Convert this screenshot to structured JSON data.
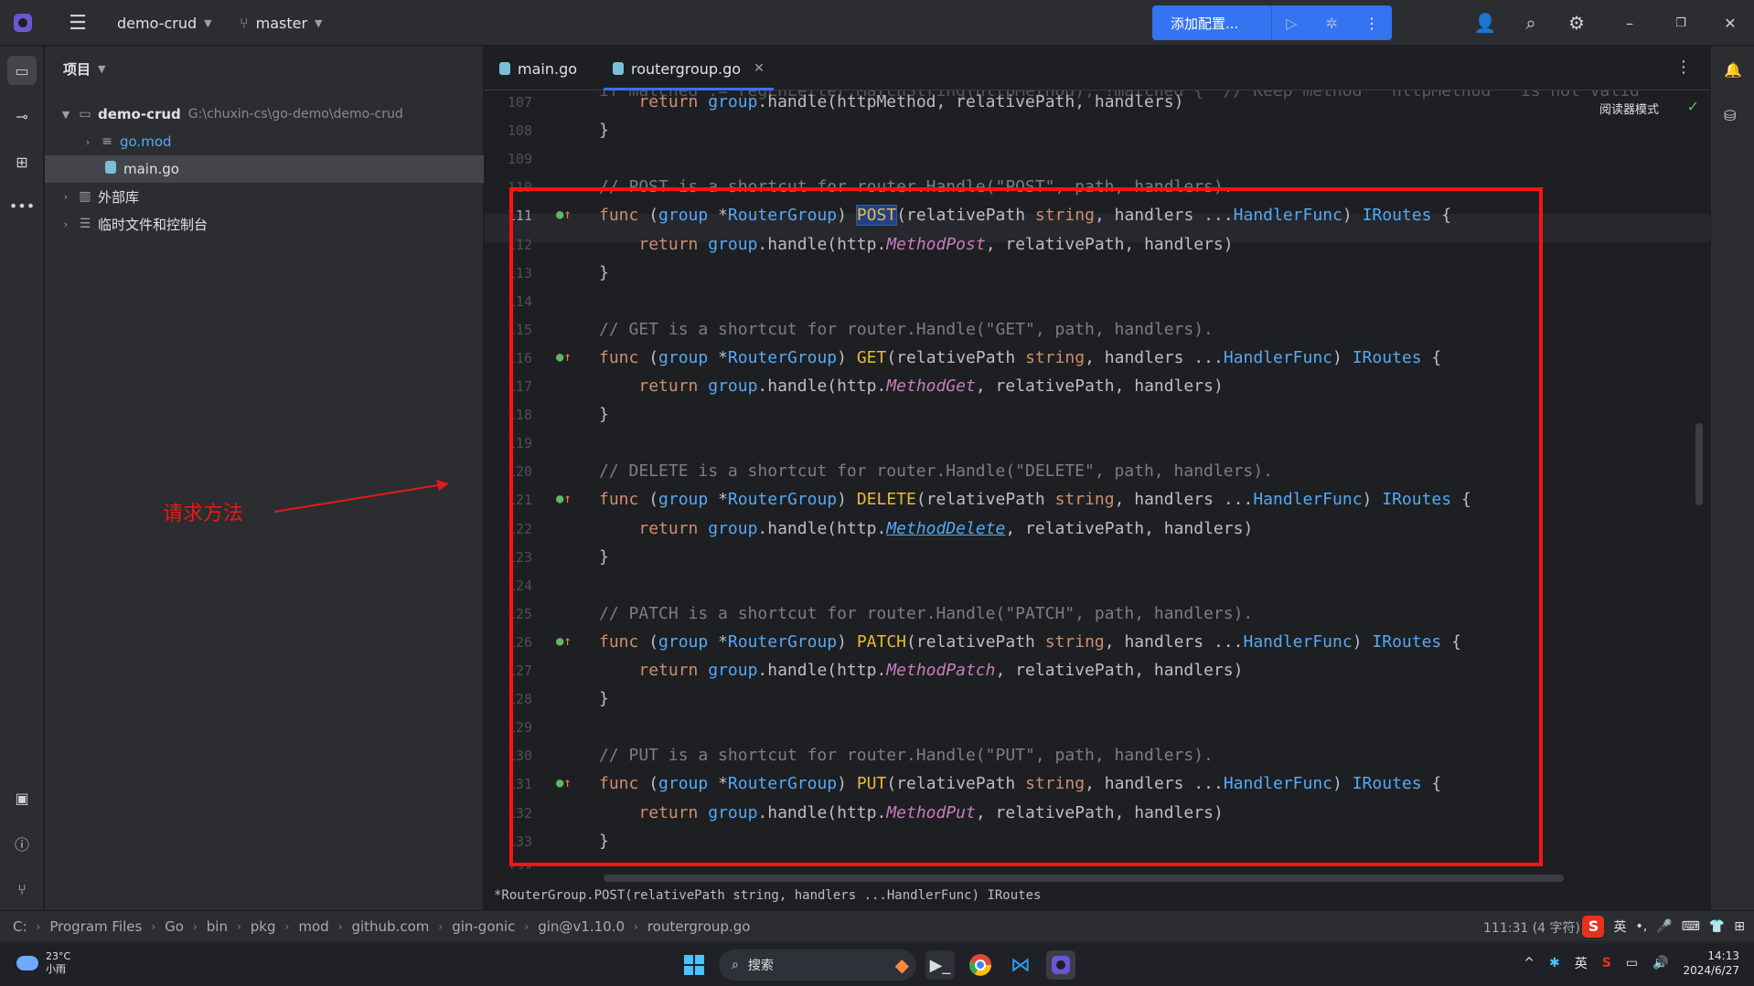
{
  "titlebar": {
    "project": "demo-crud",
    "branch": "master",
    "run_config": "添加配置..."
  },
  "project_panel": {
    "header": "项目",
    "tree": [
      {
        "label": "demo-crud",
        "path": "G:\\chuxin-cs\\go-demo\\demo-crud"
      },
      {
        "label": "go.mod"
      },
      {
        "label": "main.go"
      },
      {
        "label": "外部库"
      },
      {
        "label": "临时文件和控制台"
      }
    ]
  },
  "annotation": {
    "text": "请求方法"
  },
  "tabs": [
    {
      "label": "main.go"
    },
    {
      "label": "routergroup.go"
    }
  ],
  "editor": {
    "reader_mode": "阅读器模式",
    "top_partial": "if matched := regEnLetter.MatchString(httpMethod); !matched {  // Keep method   httpMethod   is not valid",
    "lines": [
      {
        "no": "107",
        "kind": "ret",
        "arg": "httpMethod",
        "rest": ", relativePath, handlers)"
      },
      {
        "no": "108",
        "kind": "close"
      },
      {
        "no": "109",
        "kind": "blank"
      },
      {
        "no": "110",
        "kind": "comment",
        "text": "// POST is a shortcut for router.Handle(\"POST\", path, handlers)."
      },
      {
        "no": "111",
        "kind": "func",
        "name": "POST"
      },
      {
        "no": "112",
        "kind": "ret2",
        "method": "MethodPost"
      },
      {
        "no": "113",
        "kind": "close"
      },
      {
        "no": "114",
        "kind": "blank"
      },
      {
        "no": "115",
        "kind": "comment",
        "text": "// GET is a shortcut for router.Handle(\"GET\", path, handlers)."
      },
      {
        "no": "116",
        "kind": "func",
        "name": "GET"
      },
      {
        "no": "117",
        "kind": "ret2",
        "method": "MethodGet"
      },
      {
        "no": "118",
        "kind": "close"
      },
      {
        "no": "119",
        "kind": "blank"
      },
      {
        "no": "120",
        "kind": "comment",
        "text": "// DELETE is a shortcut for router.Handle(\"DELETE\", path, handlers)."
      },
      {
        "no": "121",
        "kind": "func",
        "name": "DELETE"
      },
      {
        "no": "122",
        "kind": "ret2",
        "method": "MethodDelete"
      },
      {
        "no": "123",
        "kind": "close"
      },
      {
        "no": "124",
        "kind": "blank"
      },
      {
        "no": "125",
        "kind": "comment",
        "text": "// PATCH is a shortcut for router.Handle(\"PATCH\", path, handlers)."
      },
      {
        "no": "126",
        "kind": "func",
        "name": "PATCH"
      },
      {
        "no": "127",
        "kind": "ret2",
        "method": "MethodPatch"
      },
      {
        "no": "128",
        "kind": "close"
      },
      {
        "no": "129",
        "kind": "blank"
      },
      {
        "no": "130",
        "kind": "comment",
        "text": "// PUT is a shortcut for router.Handle(\"PUT\", path, handlers)."
      },
      {
        "no": "131",
        "kind": "func",
        "name": "PUT"
      },
      {
        "no": "132",
        "kind": "ret2",
        "method": "MethodPut"
      },
      {
        "no": "133",
        "kind": "close"
      },
      {
        "no": "134",
        "kind": "blank"
      }
    ],
    "hint": "*RouterGroup.POST(relativePath string, handlers ...HandlerFunc) IRoutes"
  },
  "statusbar": {
    "crumbs": [
      "C:",
      "Program Files",
      "Go",
      "bin",
      "pkg",
      "mod",
      "github.com",
      "gin-gonic",
      "gin@v1.10.0",
      "routergroup.go"
    ],
    "position": "111:31 (4 字符)",
    "ime_lang": "英"
  },
  "taskbar": {
    "temp": "23°C",
    "weather": "小雨",
    "search": "搜索",
    "ime": "英",
    "time": "14:13",
    "date": "2024/6/27"
  }
}
